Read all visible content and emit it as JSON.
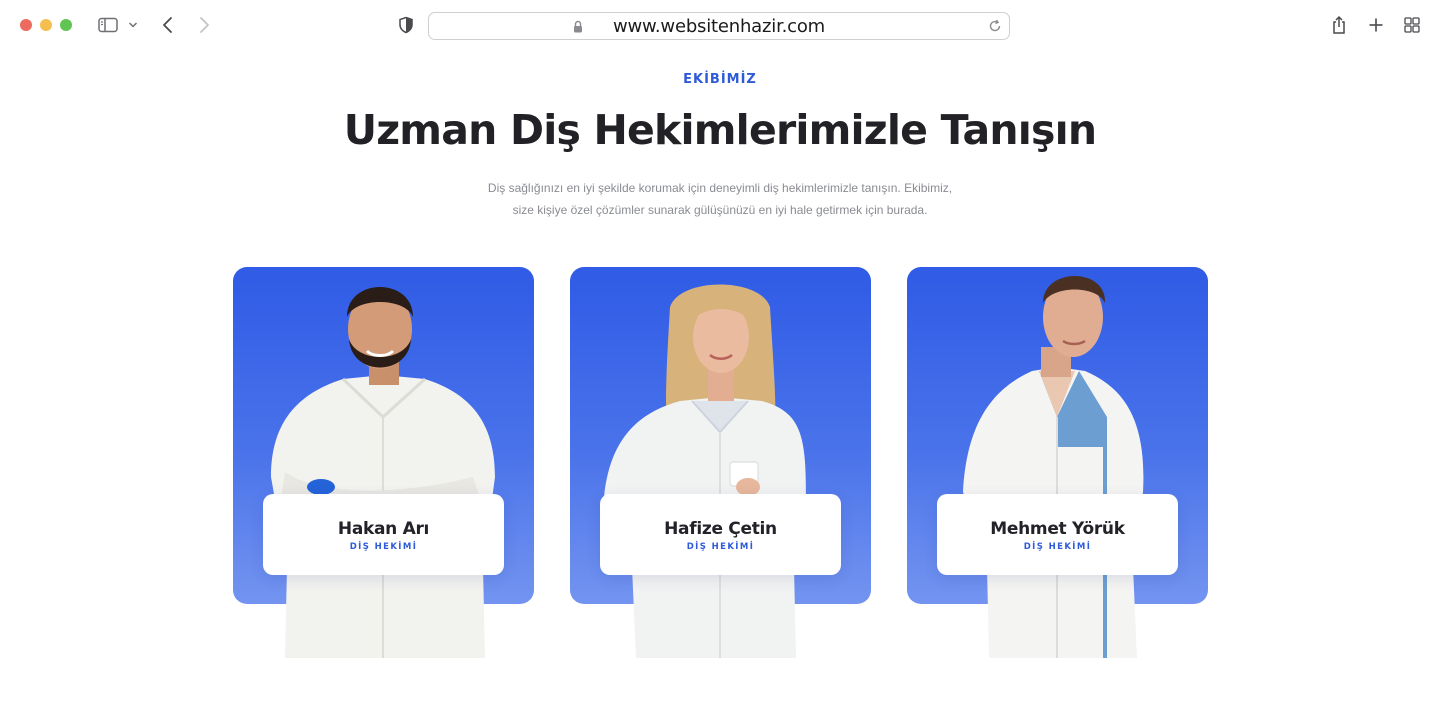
{
  "browser": {
    "url": "www.websitenhazir.com",
    "icons": [
      "sidebar-icon",
      "chevron-down-icon",
      "back-icon",
      "forward-icon",
      "shield-icon",
      "lock-icon",
      "reload-icon",
      "share-icon",
      "new-tab-icon",
      "tab-overview-icon"
    ]
  },
  "section": {
    "eyebrow": "EKİBİMİZ",
    "title": "Uzman Diş Hekimlerimizle Tanışın",
    "subtitle_line1": "Diş sağlığınızı en iyi şekilde korumak için deneyimli diş hekimlerimizle tanışın. Ekibimiz,",
    "subtitle_line2": "size kişiye özel çözümler sunarak gülüşünüzü en iyi hale getirmek için burada."
  },
  "team": [
    {
      "name": "Hakan Arı",
      "role": "DİŞ HEKİMİ"
    },
    {
      "name": "Hafize Çetin",
      "role": "DİŞ HEKİMİ"
    },
    {
      "name": "Mehmet Yörük",
      "role": "DİŞ HEKİMİ"
    }
  ],
  "colors": {
    "accent": "#2f5bd8",
    "card_gradient_top": "#2f5be6",
    "card_gradient_bottom": "#7394f0",
    "title": "#212126",
    "subtitle": "#8a8c93"
  }
}
